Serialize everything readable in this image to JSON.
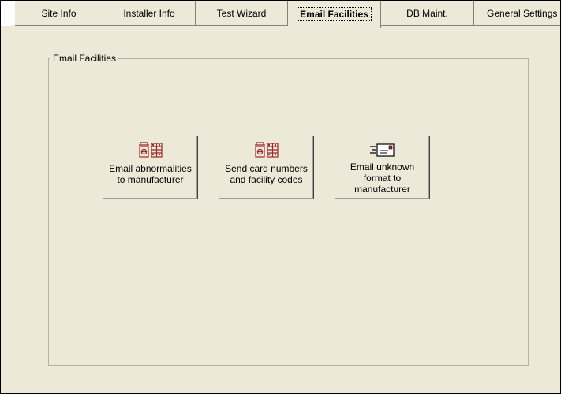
{
  "tabs": [
    {
      "label": "Site Info",
      "active": false
    },
    {
      "label": "Installer Info",
      "active": false
    },
    {
      "label": "Test Wizard",
      "active": false
    },
    {
      "label": "Email Facilities",
      "active": true
    },
    {
      "label": "DB Maint.",
      "active": false
    },
    {
      "label": "General Settings",
      "active": false
    }
  ],
  "group": {
    "title": "Email Facilities"
  },
  "buttons": [
    {
      "label_line1": "Email abnormalities",
      "label_line2": "to manufacturer",
      "icon": "building-db-icon"
    },
    {
      "label_line1": "Send card numbers",
      "label_line2": "and facility codes",
      "icon": "building-db-icon"
    },
    {
      "label_line1": "Email unknown",
      "label_line2": "format to",
      "label_line3": "manufacturer",
      "icon": "fast-mail-icon"
    }
  ]
}
